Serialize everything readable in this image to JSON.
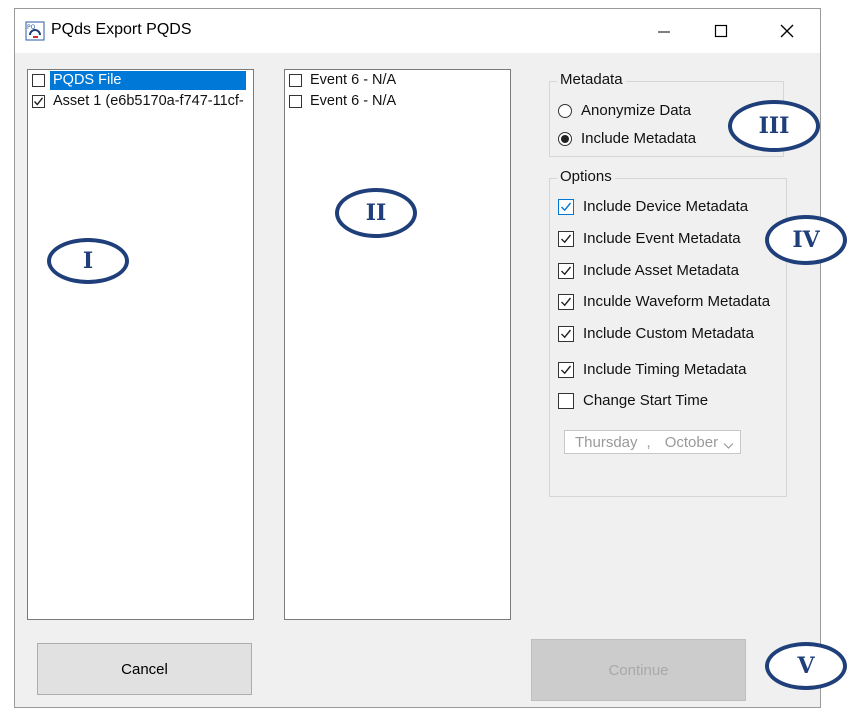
{
  "window": {
    "title": "PQds Export PQDS",
    "icon": "pqds-app-icon",
    "controls": [
      "minimize-icon",
      "maximize-icon",
      "close-icon"
    ]
  },
  "left_list": {
    "items": [
      {
        "label": "PQDS File",
        "checked": false,
        "selected": true
      },
      {
        "label": "Asset 1 (e6b5170a-f747-11cf-",
        "checked": true,
        "selected": false
      }
    ]
  },
  "middle_list": {
    "items": [
      {
        "label": "Event 6 - N/A",
        "checked": false
      },
      {
        "label": "Event 6 - N/A",
        "checked": false
      }
    ]
  },
  "metadata": {
    "title": "Metadata",
    "anonymize_label": "Anonymize Data",
    "anonymize_selected": false,
    "include_label": "Include Metadata",
    "include_selected": true
  },
  "options": {
    "title": "Options",
    "items": [
      {
        "label": "Include Device Metadata",
        "checked": true
      },
      {
        "label": "Include Event Metadata",
        "checked": true
      },
      {
        "label": "Include Asset Metadata",
        "checked": true
      },
      {
        "label": "Inculde Waveform Metadata",
        "checked": true
      },
      {
        "label": "Include Custom Metadata",
        "checked": true
      },
      {
        "label": "Include Timing Metadata",
        "checked": true
      },
      {
        "label": "Change Start Time",
        "checked": false
      }
    ],
    "date_picker": {
      "weekday": "Thursday",
      "separator": ",",
      "month": "October"
    }
  },
  "buttons": {
    "cancel": "Cancel",
    "continue": "Continue",
    "continue_enabled": false
  },
  "markers": [
    "I",
    "II",
    "III",
    "IV",
    "V"
  ],
  "colors": {
    "marker": "#1f3f7a",
    "selection": "#0078d7",
    "window_bg": "#f0f0f0"
  }
}
